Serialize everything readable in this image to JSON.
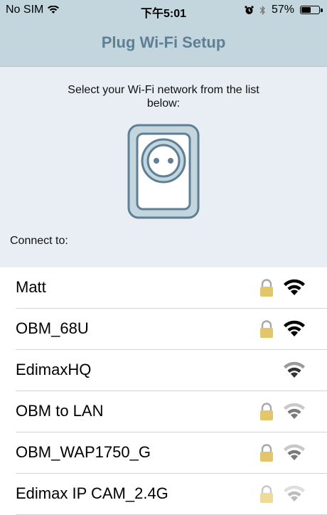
{
  "status_bar": {
    "carrier": "No SIM",
    "time": "下午5:01",
    "battery": "57%",
    "battery_level": 0.57
  },
  "nav": {
    "title": "Plug Wi-Fi Setup"
  },
  "header": {
    "instruction": "Select your Wi-Fi network from the list below:",
    "connect_label": "Connect to:"
  },
  "networks": [
    {
      "name": "Matt",
      "locked": true,
      "signal": "strong",
      "color": "#000000"
    },
    {
      "name": "OBM_68U",
      "locked": true,
      "signal": "strong",
      "color": "#000000"
    },
    {
      "name": "EdimaxHQ",
      "locked": false,
      "signal": "medium",
      "color": "#333333"
    },
    {
      "name": "OBM to LAN",
      "locked": true,
      "signal": "weak",
      "color": "#8a8a8a"
    },
    {
      "name": "OBM_WAP1750_G",
      "locked": true,
      "signal": "weak",
      "color": "#8a8a8a"
    },
    {
      "name": "Edimax IP CAM_2.4G",
      "locked": true,
      "signal": "weak",
      "color": "#c0c0c0"
    }
  ],
  "colors": {
    "nav_background": "#c4d6dd",
    "title_color": "#5e7f95",
    "plug_outline": "#5e7f95",
    "plug_fill": "#c4d6dd",
    "lock_color": "#e3c56a"
  }
}
